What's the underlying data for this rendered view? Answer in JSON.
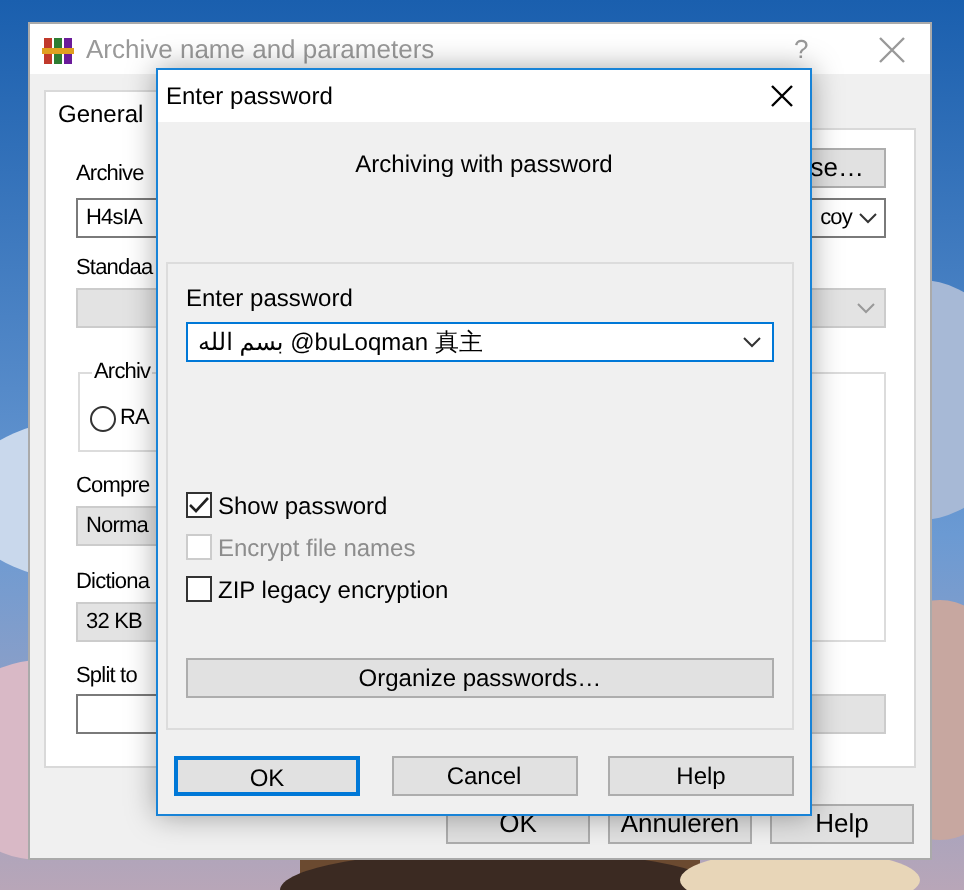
{
  "background_window": {
    "title": "Archive name and parameters",
    "help_button": "?",
    "tabs": [
      {
        "label": "General",
        "selected": true
      }
    ],
    "archive_label": "Archive",
    "browse_button": "se…",
    "archive_name_start": "H4sIA",
    "archive_name_end": "coy",
    "update_mode_label": "Standaa",
    "format_group_label": "Archiv",
    "format_options": [
      {
        "label": "RA",
        "selected": false
      }
    ],
    "compression_label": "Compre",
    "compression_value": "Norma",
    "dictionary_label": "Dictiona",
    "dictionary_value": "32 KB",
    "split_label": "Split to",
    "buttons": [
      "OK",
      "Annuleren",
      "Help"
    ]
  },
  "dialog": {
    "title": "Enter password",
    "heading": "Archiving with password",
    "password_label": "Enter password",
    "password_value": "بسم الله @buLoqman 真主",
    "options": [
      {
        "label": "Show password",
        "checked": true,
        "disabled": false
      },
      {
        "label": "Encrypt file names",
        "checked": false,
        "disabled": true
      },
      {
        "label": "ZIP legacy encryption",
        "checked": false,
        "disabled": false
      }
    ],
    "organize_button": "Organize passwords…",
    "buttons": [
      {
        "label": "OK",
        "default": true
      },
      {
        "label": "Cancel",
        "default": false
      },
      {
        "label": "Help",
        "default": false
      }
    ]
  }
}
